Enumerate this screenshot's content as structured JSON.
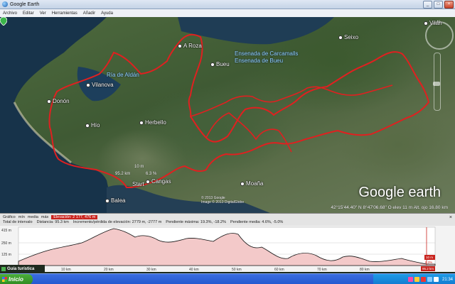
{
  "window": {
    "title": "Google Earth"
  },
  "menu": [
    "Archivo",
    "Editar",
    "Ver",
    "Herramientas",
    "Añadir",
    "Ayuda"
  ],
  "map": {
    "places": [
      {
        "name": "A Roza",
        "id": "a-roza"
      },
      {
        "name": "Bueu",
        "id": "bueu"
      },
      {
        "name": "Seixo",
        "id": "seixo"
      },
      {
        "name": "Vilanova",
        "id": "vilanova"
      },
      {
        "name": "Donón",
        "id": "donon"
      },
      {
        "name": "Hío",
        "id": "hio"
      },
      {
        "name": "Herbello",
        "id": "herbello"
      },
      {
        "name": "Cangas",
        "id": "cangas"
      },
      {
        "name": "Moaña",
        "id": "moana"
      },
      {
        "name": "Balea",
        "id": "balea"
      },
      {
        "name": "Start",
        "id": "start"
      },
      {
        "name": "Vilán",
        "id": "vilan"
      }
    ],
    "water": [
      {
        "text": "Ensenada de Carcamalls",
        "id": "ensenada-carcamalls"
      },
      {
        "text": "Ensenada de Bueu",
        "id": "ensenada-bueu"
      },
      {
        "text": "Ría de Aldán",
        "id": "ria-aldan"
      }
    ],
    "dist_start": "95.2 km",
    "dist_top": "10 m",
    "dist_side": "6.3 %",
    "watermark_google": "Google",
    "watermark_earth": "earth",
    "credit_line1": "© 2013 Google",
    "credit_line2": "Image © 2013 DigitalGlobe",
    "status": "42°15'44.40\" N   8°47'06.68\" O   elev   11 m   Alt. ojo  16.80 km",
    "north": "N"
  },
  "elevation": {
    "graph_label": "Gráfico",
    "graph_min": "mín",
    "graph_mid": "media",
    "graph_max": "máx",
    "elevation_label": "Elevación: 2  177, 476 m",
    "total_label": "Total de intervalo",
    "distance": "Distancia: 95.3 km",
    "gain_loss": "Incremento/pérdida de elevación: 2779 m, -2777 m",
    "max_slope": "Pendiente máxima: 19.3%, -18.2%",
    "avg_slope": "Pendiente media: 4.6%, -5.0%",
    "close": "×",
    "y_ticks": [
      "415 m",
      "250 m",
      "125 m"
    ],
    "x_ticks": [
      "10 km",
      "20 km",
      "30 km",
      "40 km",
      "50 km",
      "60 km",
      "70 km",
      "80 km"
    ],
    "end_top": "10 m",
    "end_mid": "6.3%",
    "end_bottom": "95.2 km"
  },
  "guide": {
    "label": "Guía turística"
  },
  "taskbar": {
    "start": "Inicio",
    "clock": "21:34"
  },
  "colors": {
    "track": "#e02020",
    "fill": "#f3c9c9",
    "profile": "#111111"
  }
}
